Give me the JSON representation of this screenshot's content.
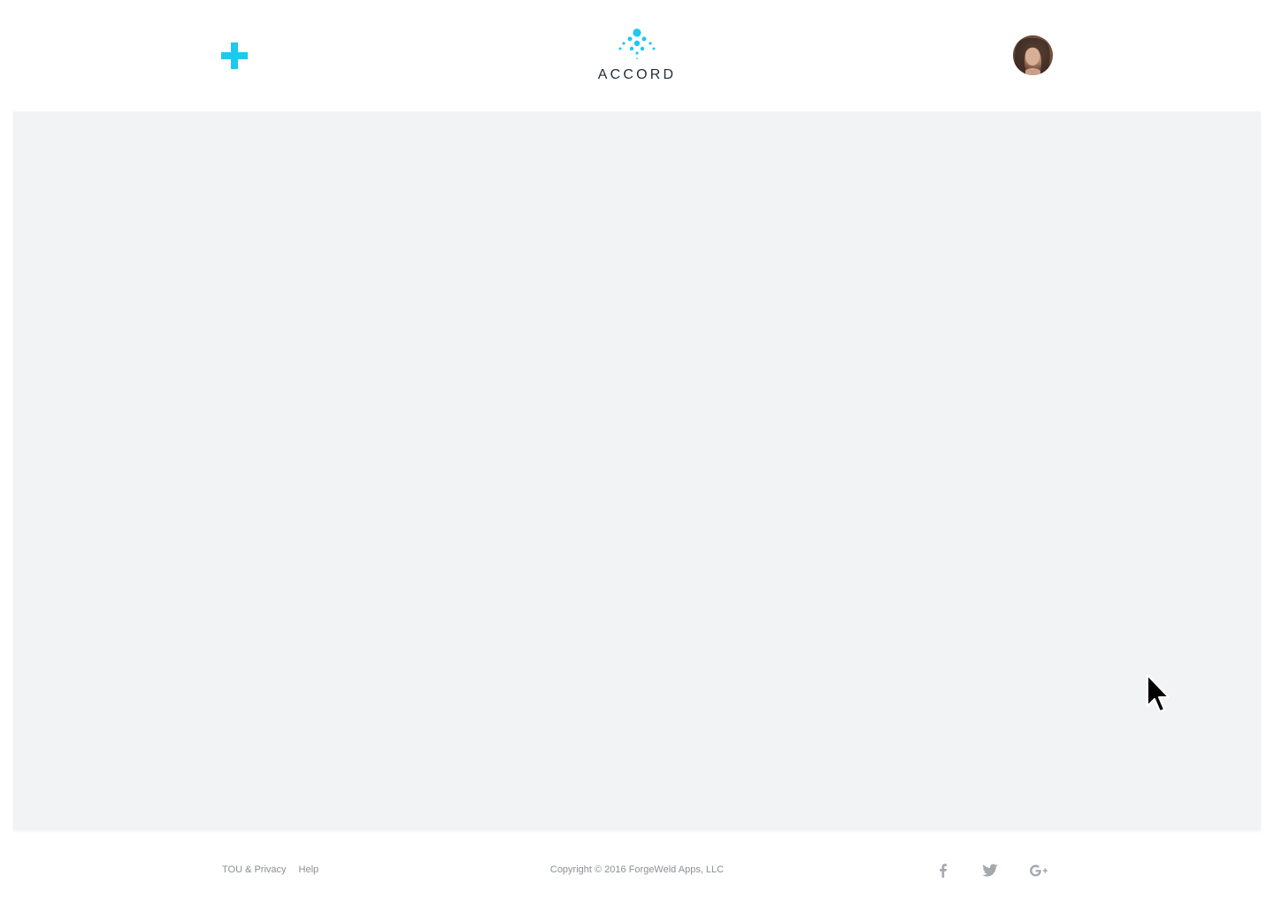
{
  "header": {
    "add_icon": "plus-icon",
    "logo_text": "ACCORD",
    "avatar_icon": "user-avatar"
  },
  "content": {},
  "footer": {
    "links": [
      {
        "label": "TOU & Privacy"
      },
      {
        "label": "Help"
      }
    ],
    "copyright": "Copyright © 2016 ForgeWeld Apps, LLC",
    "social": [
      "facebook-icon",
      "twitter-icon",
      "google-plus-icon"
    ]
  },
  "colors": {
    "accent": "#1ec8f0",
    "text_dark": "#1f2e3a",
    "text_muted": "#8a8f96",
    "content_bg": "#f2f3f5",
    "icon_gray": "#a5a9ae"
  }
}
